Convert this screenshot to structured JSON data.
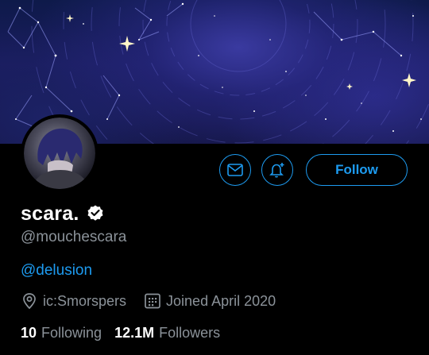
{
  "profile": {
    "display_name": "scara.",
    "handle": "@mouchescara",
    "bio": "@delusion",
    "location": "ic:Smorspers",
    "joined": "Joined April 2020"
  },
  "actions": {
    "message_icon": "envelope-icon",
    "notify_icon": "bell-plus-icon",
    "follow_label": "Follow"
  },
  "stats": {
    "following_count": "10",
    "following_label": "Following",
    "followers_count": "12.1M",
    "followers_label": "Followers"
  },
  "colors": {
    "accent": "#1d9bf0",
    "secondary_text": "#8b9299",
    "background": "#000000"
  }
}
